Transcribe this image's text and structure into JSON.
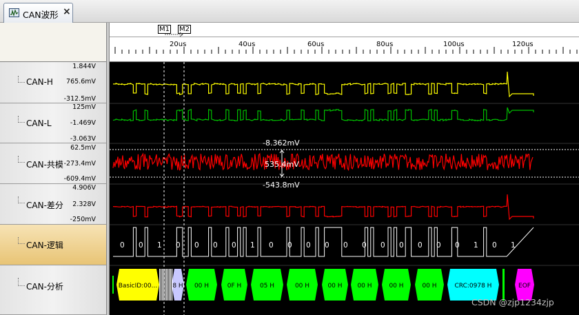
{
  "tab": {
    "label": "CAN波形",
    "close": "×",
    "icon": "waveform-window-icon"
  },
  "markers": [
    {
      "label": "M1"
    },
    {
      "label": "M2"
    }
  ],
  "time_axis": {
    "labels": [
      "20us",
      "40us",
      "60us",
      "80us",
      "100us",
      "120us"
    ]
  },
  "channels": [
    {
      "name": "CAN-H",
      "scale_top": "1.844V",
      "scale_mid": "765.6mV",
      "scale_bottom": "-312.5mV",
      "color": "#ffff00"
    },
    {
      "name": "CAN-L",
      "scale_top": "125mV",
      "scale_mid": "-1.469V",
      "scale_bottom": "-3.063V",
      "color": "#00c000"
    },
    {
      "name": "CAN-共模",
      "scale_top": "62.5mV",
      "scale_mid": "-273.4mV",
      "scale_bottom": "-609.4mV",
      "color": "#ff0000"
    },
    {
      "name": "CAN-差分",
      "scale_top": "4.906V",
      "scale_mid": "2.328V",
      "scale_bottom": "-250mV",
      "color": "#ff0000"
    },
    {
      "name": "CAN-逻辑",
      "color": "#ffffff"
    },
    {
      "name": "CAN-分析"
    }
  ],
  "measurements": {
    "top": "-8.362mV",
    "delta": "535.4mV",
    "bottom": "-543.8mV"
  },
  "logic_bits": [
    "0",
    "0",
    "1",
    "0",
    "0",
    "0",
    "0",
    "1",
    "0",
    "0",
    "0",
    "0",
    "0",
    "0",
    "0",
    "0",
    "0",
    "0",
    "0",
    "1",
    "0",
    "1"
  ],
  "frames": [
    {
      "text": "BasicID:00...",
      "color": "#ffff00"
    },
    {
      "text": "8 H",
      "color": "#c8c8ff"
    },
    {
      "text": "00 H",
      "color": "#00ff00"
    },
    {
      "text": "0F H",
      "color": "#00ff00"
    },
    {
      "text": "05 H",
      "color": "#00ff00"
    },
    {
      "text": "00 H",
      "color": "#00ff00"
    },
    {
      "text": "00 H",
      "color": "#00ff00"
    },
    {
      "text": "00 H",
      "color": "#00ff00"
    },
    {
      "text": "00 H",
      "color": "#00ff00"
    },
    {
      "text": "00 H",
      "color": "#00ff00"
    },
    {
      "text": "CRC:0978 H",
      "color": "#00ffff"
    },
    {
      "text": "EOF",
      "color": "#ff00ff"
    }
  ],
  "watermark": "CSDN @zjp1234zjp"
}
